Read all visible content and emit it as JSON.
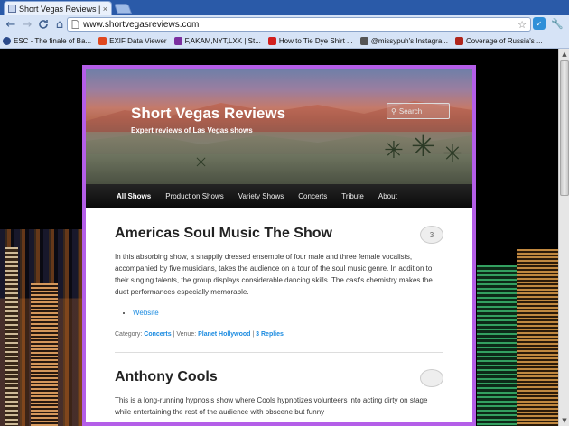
{
  "browser": {
    "tab_title": "Short Vegas Reviews | Expert",
    "tab_close": "×",
    "url": "www.shortvegasreviews.com",
    "nav": {
      "back": "←",
      "forward": "→",
      "reload": "C",
      "home": "⌂"
    },
    "bookmarks": [
      {
        "label": "ESC - The finale of Ba...",
        "icon_color": "#2b4a8a",
        "icon": "globe-icon"
      },
      {
        "label": "EXIF Data Viewer",
        "icon_color": "#e0481f",
        "icon": "exif-icon"
      },
      {
        "label": "F,AKAM,NYT,LXK | St...",
        "icon_color": "#7b2fa0",
        "icon": "yahoo-icon"
      },
      {
        "label": "How to Tie Dye Shirt ...",
        "icon_color": "#d2201e",
        "icon": "youtube-icon"
      },
      {
        "label": "@missypuh's Instagra...",
        "icon_color": "#555555",
        "icon": "instagram-icon"
      },
      {
        "label": "Coverage of Russia's ...",
        "icon_color": "#b0261c",
        "icon": "news-icon"
      }
    ]
  },
  "site": {
    "title": "Short Vegas Reviews",
    "description": "Expert reviews of Las Vegas shows",
    "search_placeholder": "Search",
    "accent_border": "#b45ee8",
    "menu": [
      "All Shows",
      "Production Shows",
      "Variety Shows",
      "Concerts",
      "Tribute",
      "About"
    ]
  },
  "posts": [
    {
      "title": "Americas Soul Music The Show",
      "comments": "3",
      "content": "In this absorbing show, a snappily dressed ensemble of four male and three female vocalists, accompanied by five musicians, takes the audience on a tour of the soul music genre. In addition to their singing talents, the group displays considerable dancing skills. The cast's chemistry makes the duet performances especially memorable.",
      "link": "Website",
      "meta": {
        "category_label": "Category: ",
        "category": "Concerts",
        "venue_label": " | Venue: ",
        "venue": "Planet Hollywood",
        "sep": " | ",
        "replies": "3 Replies"
      }
    },
    {
      "title": "Anthony Cools",
      "comments": "",
      "content": "This is a long-running hypnosis show where Cools hypnotizes volunteers into acting dirty on stage while entertaining the rest of the audience with obscene but funny"
    }
  ]
}
